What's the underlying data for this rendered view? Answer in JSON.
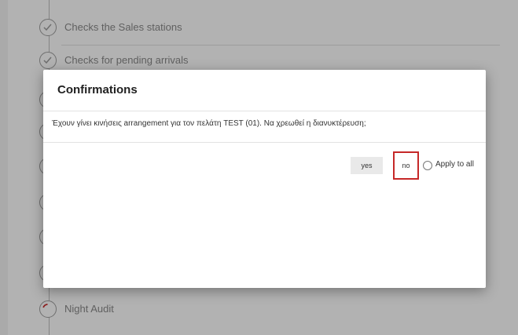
{
  "steps": [
    {
      "label": "Checks the Sales stations",
      "status": "done",
      "icon": "check-icon"
    },
    {
      "label": "Checks for pending arrivals",
      "status": "done",
      "icon": "check-icon"
    },
    {
      "label": "",
      "status": "pending",
      "icon": "circle-icon"
    },
    {
      "label": "",
      "status": "pending",
      "icon": "circle-icon"
    },
    {
      "label": "",
      "status": "pending",
      "icon": "circle-icon"
    },
    {
      "label": "",
      "status": "pending",
      "icon": "circle-icon"
    },
    {
      "label": "",
      "status": "pending",
      "icon": "circle-icon"
    },
    {
      "label": "",
      "status": "pending",
      "icon": "circle-icon"
    },
    {
      "label": "Night Audit",
      "status": "in-progress",
      "icon": "spinner-icon"
    }
  ],
  "dialog": {
    "title": "Confirmations",
    "message": "Έχουν γίνει κινήσεις arrangement για τον πελάτη TEST (01). Να χρεωθεί η διανυκτέρευση;",
    "yes_label": "yes",
    "no_label": "no",
    "apply_all_label": "Apply to all",
    "apply_all_checked": false
  },
  "colors": {
    "highlight": "#c62828",
    "spinner": "#c62828",
    "overlay": "rgba(0,0,0,0.30)"
  }
}
